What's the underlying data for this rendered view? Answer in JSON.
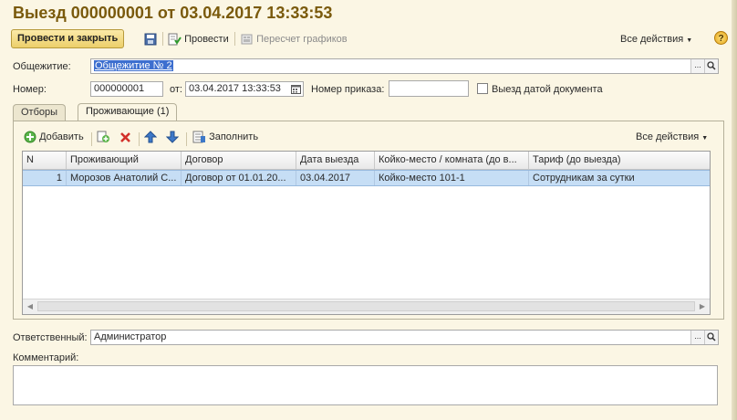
{
  "window": {
    "title": "Выезд 000000001 от 03.04.2017 13:33:53"
  },
  "toolbar": {
    "post_and_close": "Провести и закрыть",
    "save_icon": "floppy-disk-icon",
    "post": "Провести",
    "recalc": "Пересчет графиков",
    "all_actions": "Все действия",
    "help": "?"
  },
  "form": {
    "dorm_label": "Общежитие:",
    "dorm_value": "Общежитие № 2",
    "dorm_btn": "...",
    "number_label": "Номер:",
    "number_value": "000000001",
    "date_label": "от:",
    "date_value": "03.04.2017 13:33:53",
    "order_label": "Номер приказа:",
    "order_value": "",
    "checkout_by_doc_label": "Выезд датой документа",
    "checkout_by_doc_checked": false
  },
  "tabs": [
    {
      "label": "Отборы",
      "active": false
    },
    {
      "label": "Проживающие (1)",
      "active": true
    }
  ],
  "grid_toolbar": {
    "add": "Добавить",
    "fill": "Заполнить",
    "all_actions": "Все действия"
  },
  "table": {
    "columns": [
      "N",
      "Проживающий",
      "Договор",
      "Дата выезда",
      "Койко-место / комната (до в...",
      "Тариф (до выезда)"
    ],
    "rows": [
      [
        "1",
        "Морозов Анатолий С...",
        "Договор  от 01.01.20...",
        "03.04.2017",
        "Койко-место 101-1",
        "Сотрудникам за сутки"
      ]
    ]
  },
  "responsible": {
    "label": "Ответственный:",
    "value": "Администратор",
    "btn": "..."
  },
  "comment": {
    "label": "Комментарий:",
    "value": ""
  },
  "colors": {
    "title": "#7a5a0c",
    "background": "#fbf6e4",
    "selected_row": "#c6def5",
    "primary_button": "#eccf6a"
  }
}
